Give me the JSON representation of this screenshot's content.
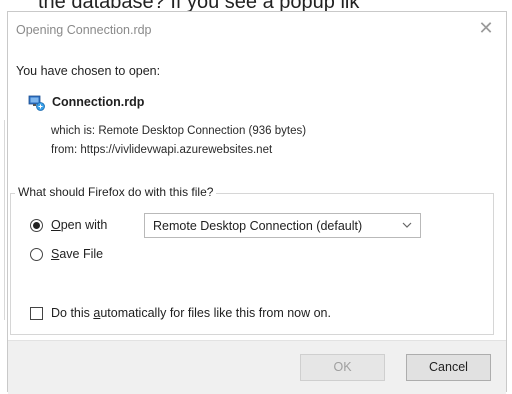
{
  "background": {
    "cutoff_text": "the database? If you see a popup lik"
  },
  "dialog": {
    "title": "Opening Connection.rdp",
    "close_glyph": "✕",
    "intro_text": "You have chosen to open:",
    "file": {
      "name": "Connection.rdp",
      "icon": "remote-desktop-file-icon"
    },
    "which_is_label": "which is:",
    "which_is_value": "Remote Desktop Connection (936 bytes)",
    "from_label": "from:",
    "from_value": "https://vivlidevwapi.azurewebsites.net",
    "group_legend": "What should Firefox do with this file?",
    "open_with": {
      "label": "Open with",
      "selected": true,
      "app": "Remote Desktop Connection (default)"
    },
    "save_file": {
      "label": "Save File",
      "selected": false
    },
    "auto_checkbox": {
      "label": "Do this automatically for files like this from now on.",
      "checked": false
    },
    "buttons": {
      "ok": "OK",
      "cancel": "Cancel"
    }
  }
}
